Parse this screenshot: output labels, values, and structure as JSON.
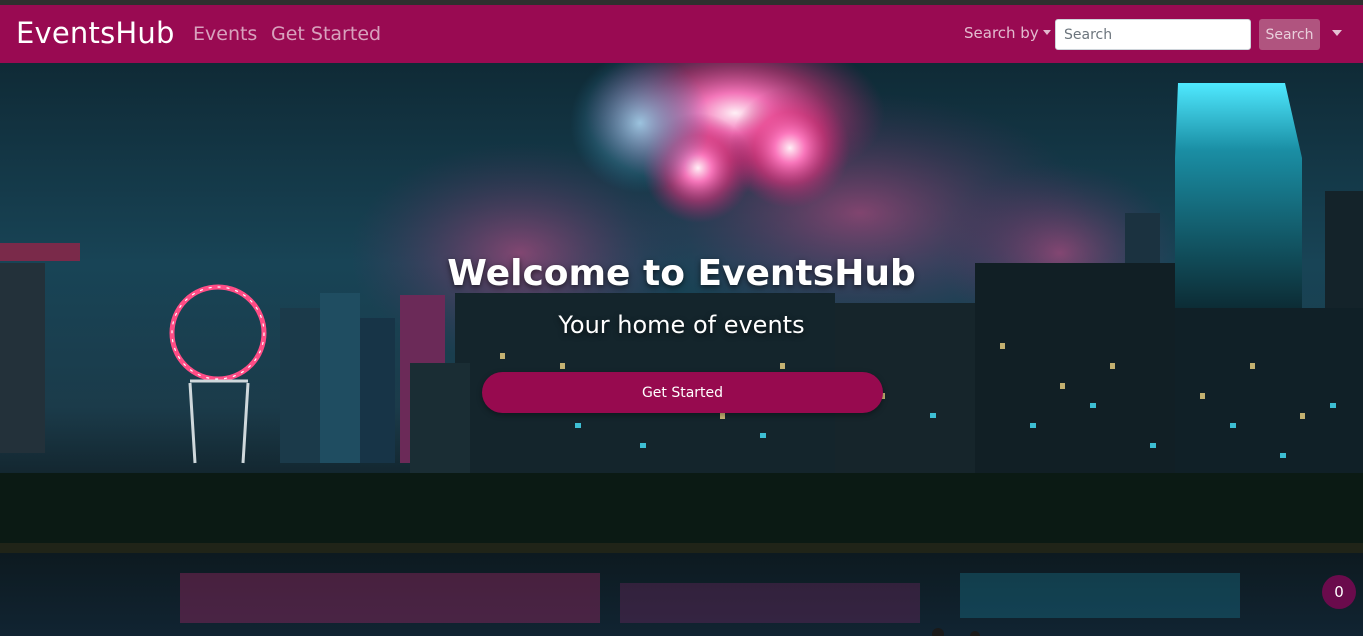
{
  "navbar": {
    "brand": "EventsHub",
    "links": [
      "Events",
      "Get Started"
    ],
    "search_by_label": "Search by",
    "search_placeholder": "Search",
    "search_button": "Search",
    "accent_color": "#990a52"
  },
  "hero": {
    "title": "Welcome to EventsHub",
    "subtitle": "Your home of events",
    "cta_label": "Get Started",
    "cta_color": "#970a4f"
  },
  "badge": {
    "count": "0"
  },
  "icons": [
    "caret-down-icon",
    "user-menu-caret-icon"
  ]
}
